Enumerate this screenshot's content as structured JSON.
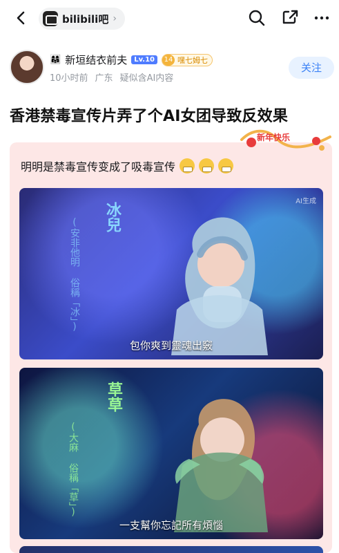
{
  "nav": {
    "forum_name": "bilibili吧",
    "forum_chevron": "›"
  },
  "author": {
    "emoji": "👩‍👩‍👧",
    "name": "新垣结衣前夫",
    "level": "Lv.10",
    "medal_level": "14",
    "medal_text": "嘿七姆七",
    "time": "10小时前",
    "location": "广东",
    "ai_note": "疑似含AI内容",
    "follow_label": "关注"
  },
  "post": {
    "title": "香港禁毒宣传片弄了个AI女团导致反效果",
    "quote": "明明是禁毒宣传变成了吸毒宣传",
    "deco_text": "新年快乐"
  },
  "images": [
    {
      "vertical_title": "冰兒",
      "vertical_sub": "(安非他明 俗稱「冰」)",
      "ai_tag": "AI生成",
      "subtitle": "包你爽到靈魂出竅"
    },
    {
      "vertical_title": "草草",
      "vertical_sub": "(大麻 俗稱「草」)",
      "subtitle": "一支幫你忘記所有煩惱"
    }
  ],
  "colors": {
    "follow_text": "#3b82f6",
    "follow_bg": "#e8f2ff",
    "card_bg": "#fde7e6",
    "level_badge": "#4f7cff",
    "medal": "#f4b43b"
  },
  "icons": [
    "back-icon",
    "forum-logo-icon",
    "search-icon",
    "share-icon",
    "more-icon"
  ]
}
